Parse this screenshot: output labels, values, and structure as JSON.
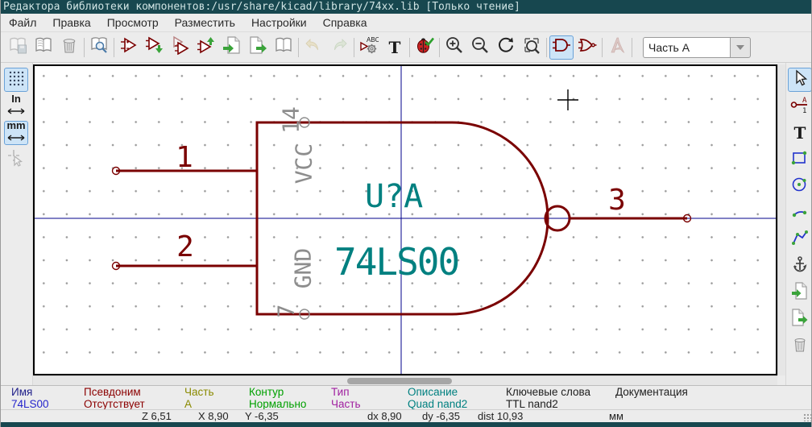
{
  "window": {
    "title": "Редактора библиотеки компонентов:/usr/share/kicad/library/74xx.lib [Только чтение]"
  },
  "menu_bar": {
    "items": [
      {
        "label": "Файл"
      },
      {
        "label": "Правка"
      },
      {
        "label": "Просмотр"
      },
      {
        "label": "Разместить"
      },
      {
        "label": "Настройки"
      },
      {
        "label": "Справка"
      }
    ]
  },
  "main_toolbar": {
    "part_selector_value": "Часть A"
  },
  "left_toolbar": {
    "inches_label": "In",
    "mm_label": "mm"
  },
  "icons": {
    "t_label": "T",
    "abc_label": "ABC",
    "pin_name_glyph": "A",
    "pin_number_glyph": "1"
  },
  "canvas": {
    "reference": "U?A",
    "value": "74LS00",
    "pins": {
      "input1_number": "1",
      "input2_number": "2",
      "output_number": "3",
      "power_number": "14",
      "power_name": "VCC",
      "ground_number": "7",
      "ground_name": "GND"
    }
  },
  "info_panel": {
    "fields": [
      {
        "label": "Имя",
        "value": "74LS00"
      },
      {
        "label": "Псевдоним",
        "value": "Отсутствует"
      },
      {
        "label": "Часть",
        "value": "A"
      },
      {
        "label": "Контур",
        "value": "Нормально"
      },
      {
        "label": "Тип",
        "value": "Часть"
      },
      {
        "label": "Описание",
        "value": "Quad nand2"
      },
      {
        "label": "Ключевые слова",
        "value": "TTL nand2"
      },
      {
        "label": "Документация",
        "value": ""
      }
    ]
  },
  "status_bar": {
    "zoom": "Z 6,51",
    "cursor_x": "X 8,90",
    "cursor_y": "Y -6,35",
    "dx": "dx 8,90",
    "dy": "dy -6,35",
    "dist": "dist 10,93",
    "units": "мм"
  },
  "colors": {
    "title_bar": "#17474f",
    "symbol_outline": "#7a0000",
    "symbol_text": "#008080",
    "hidden_pin_gray": "#8d8d8d",
    "crosshair_blue": "#00008b",
    "selected_tool_bg": "#cde4f7",
    "selected_tool_border": "#6aa2d8"
  }
}
